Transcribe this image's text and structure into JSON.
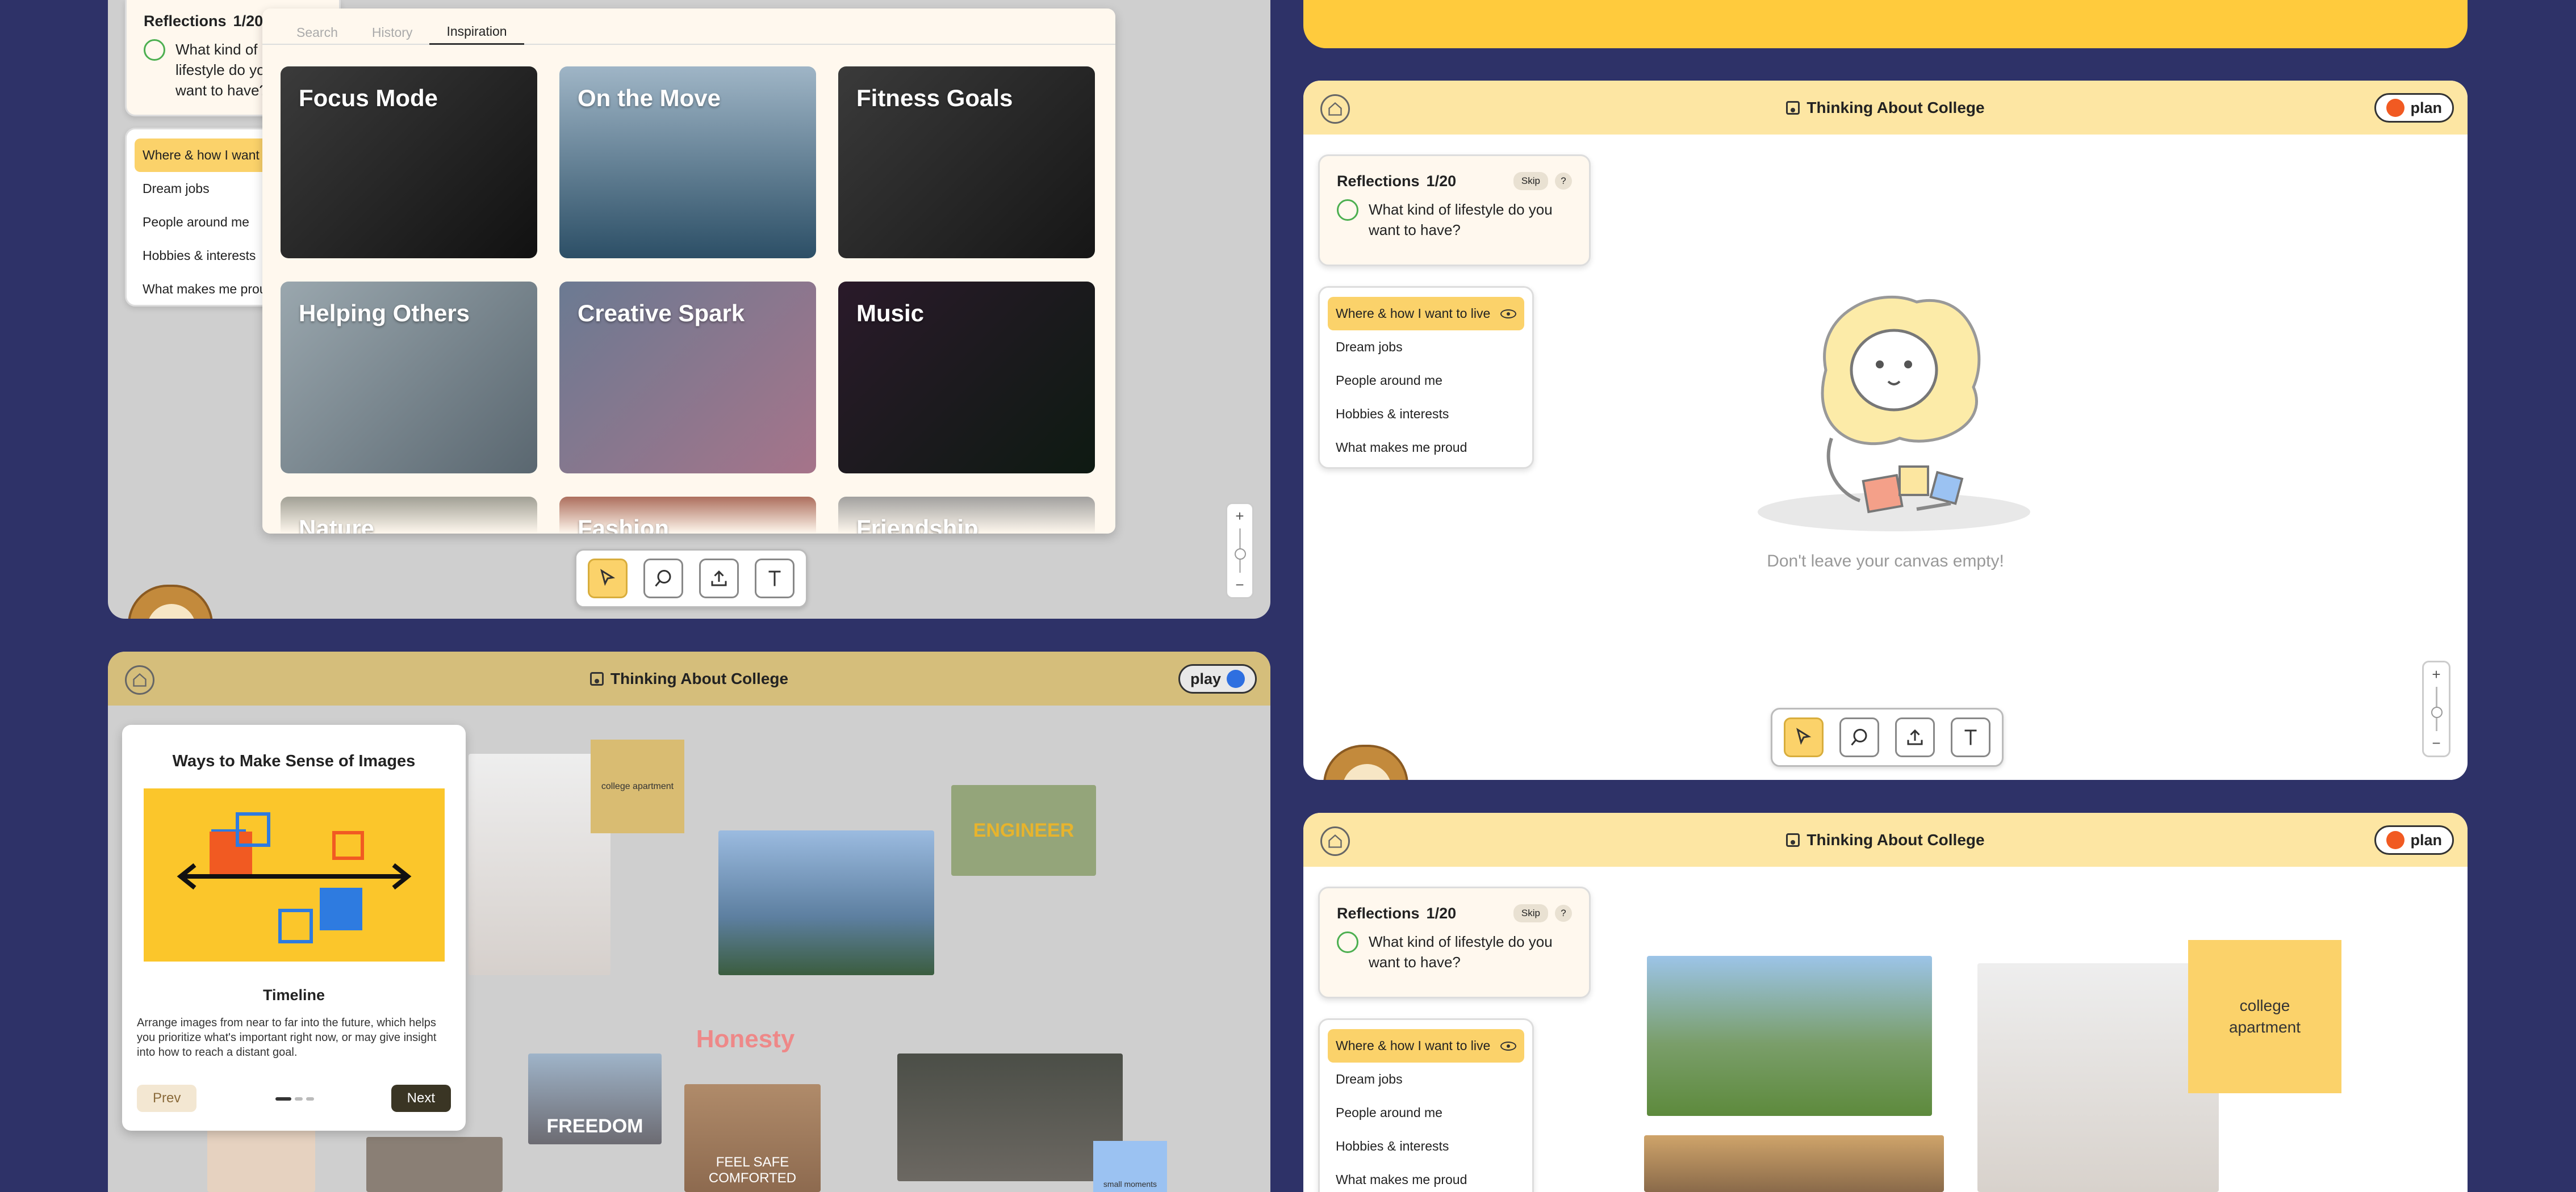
{
  "panel_top_left": {
    "reflections": {
      "title": "Reflections",
      "count": "1/20",
      "question": "What kind of lifestyle do you want to have?"
    },
    "menu": [
      "Where & how I want to live",
      "Dream jobs",
      "People around me",
      "Hobbies & interests",
      "What makes me proud"
    ],
    "inspiration": {
      "tabs": [
        "Search",
        "History",
        "Inspiration"
      ],
      "active_tab": "Inspiration",
      "tiles": [
        "Focus Mode",
        "On the Move",
        "Fitness Goals",
        "Helping Others",
        "Creative Spark",
        "Music",
        "Nature",
        "Fashion",
        "Friendship"
      ]
    }
  },
  "panel_empty": {
    "title": "Thinking About College",
    "mode": "plan",
    "mode_color": "#F15A22",
    "reflections": {
      "title": "Reflections",
      "count": "1/20",
      "skip": "Skip",
      "help": "?",
      "question": "What kind of lifestyle do you want to have?"
    },
    "menu": [
      "Where & how I want to live",
      "Dream jobs",
      "People around me",
      "Hobbies & interests",
      "What makes me proud"
    ],
    "empty_message": "Don't leave your canvas empty!"
  },
  "panel_guide": {
    "title": "Thinking About College",
    "mode": "play",
    "mode_color": "#2E6FE0",
    "guide": {
      "heading": "Ways to Make Sense of Images",
      "subtitle": "Timeline",
      "body": "Arrange images from near to far into the future, which helps you prioritize what's important right now, or may give insight into how to reach a distant goal.",
      "prev": "Prev",
      "next": "Next"
    },
    "stickies": {
      "college": "college apartment",
      "small": "small moments"
    },
    "photo_texts": {
      "freedom": "FREEDOM",
      "honesty": "Honesty",
      "safe": "FEEL SAFE COMFORTED",
      "engineer": "ENGINEER"
    }
  },
  "panel_bottom_right": {
    "title": "Thinking About College",
    "mode": "plan",
    "mode_color": "#F15A22",
    "reflections": {
      "title": "Reflections",
      "count": "1/20",
      "skip": "Skip",
      "help": "?",
      "question": "What kind of lifestyle do you want to have?"
    },
    "menu": [
      "Where & how I want to live",
      "Dream jobs",
      "People around me",
      "Hobbies & interests",
      "What makes me proud"
    ],
    "sticky": "college apartment"
  },
  "zoom": {
    "plus": "+",
    "minus": "−"
  },
  "colors": {
    "background": "#2E3268",
    "accent_yellow": "#FBD26A",
    "header_tan": "#D5BE7B",
    "header_cream": "#FDE6A3"
  }
}
